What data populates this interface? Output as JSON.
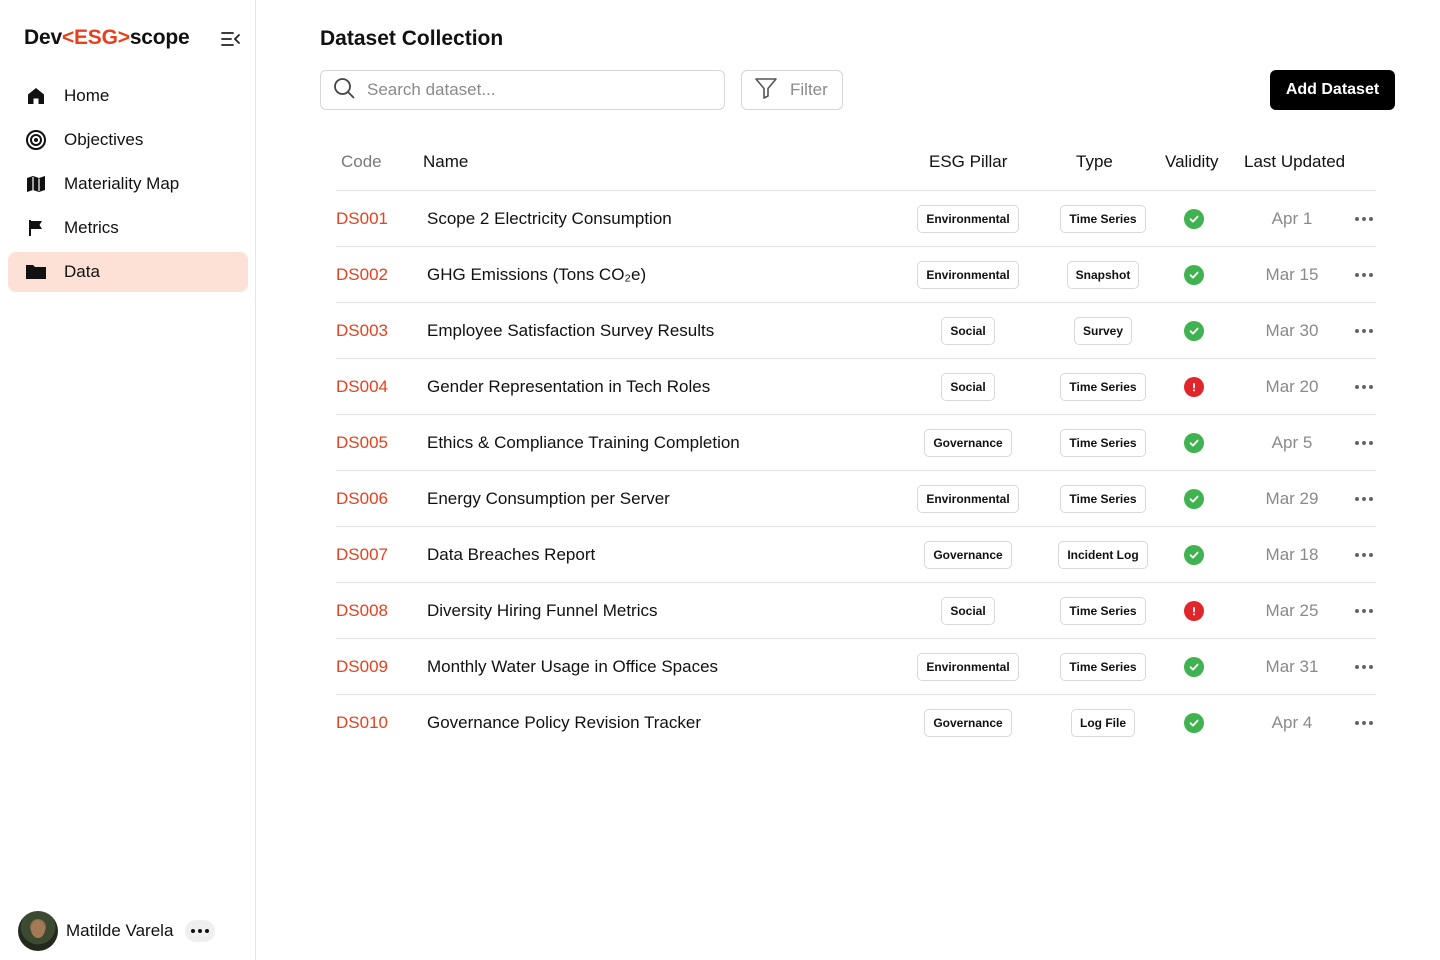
{
  "brand": {
    "prefix": "Dev",
    "accent": "<ESG>",
    "suffix": "scope"
  },
  "nav": [
    {
      "label": "Home",
      "icon": "home-icon",
      "active": false
    },
    {
      "label": "Objectives",
      "icon": "target-icon",
      "active": false
    },
    {
      "label": "Materiality Map",
      "icon": "map-icon",
      "active": false
    },
    {
      "label": "Metrics",
      "icon": "flag-icon",
      "active": false
    },
    {
      "label": "Data",
      "icon": "folder-icon",
      "active": true
    }
  ],
  "user": {
    "name": "Matilde Varela"
  },
  "page": {
    "title": "Dataset Collection"
  },
  "search": {
    "placeholder": "Search dataset..."
  },
  "filter": {
    "label": "Filter"
  },
  "add_button": {
    "label": "Add Dataset"
  },
  "table": {
    "headers": {
      "code": "Code",
      "name": "Name",
      "pillar": "ESG Pillar",
      "type": "Type",
      "validity": "Validity",
      "updated": "Last Updated"
    },
    "rows": [
      {
        "code": "DS001",
        "name": "Scope 2 Electricity Consumption",
        "pillar": "Environmental",
        "type": "Time Series",
        "valid": true,
        "updated": "Apr 1"
      },
      {
        "code": "DS002",
        "name": "GHG Emissions (Tons CO₂e)",
        "pillar": "Environmental",
        "type": "Snapshot",
        "valid": true,
        "updated": "Mar 15"
      },
      {
        "code": "DS003",
        "name": "Employee Satisfaction Survey Results",
        "pillar": "Social",
        "type": "Survey",
        "valid": true,
        "updated": "Mar 30"
      },
      {
        "code": "DS004",
        "name": "Gender Representation in Tech Roles",
        "pillar": "Social",
        "type": "Time Series",
        "valid": false,
        "updated": "Mar 20"
      },
      {
        "code": "DS005",
        "name": "Ethics & Compliance Training Completion",
        "pillar": "Governance",
        "type": "Time Series",
        "valid": true,
        "updated": "Apr 5"
      },
      {
        "code": "DS006",
        "name": "Energy Consumption per Server",
        "pillar": "Environmental",
        "type": "Time Series",
        "valid": true,
        "updated": "Mar 29"
      },
      {
        "code": "DS007",
        "name": "Data Breaches Report",
        "pillar": "Governance",
        "type": "Incident Log",
        "valid": true,
        "updated": "Mar 18"
      },
      {
        "code": "DS008",
        "name": "Diversity Hiring Funnel Metrics",
        "pillar": "Social",
        "type": "Time Series",
        "valid": false,
        "updated": "Mar 25"
      },
      {
        "code": "DS009",
        "name": "Monthly Water Usage in Office Spaces",
        "pillar": "Environmental",
        "type": "Time Series",
        "valid": true,
        "updated": "Mar 31"
      },
      {
        "code": "DS010",
        "name": "Governance Policy Revision Tracker",
        "pillar": "Governance",
        "type": "Log File",
        "valid": true,
        "updated": "Apr 4"
      }
    ]
  },
  "colors": {
    "accent": "#e8401c",
    "active_bg": "#fde0d6",
    "valid": "#3fb34f",
    "invalid": "#e0262b"
  }
}
